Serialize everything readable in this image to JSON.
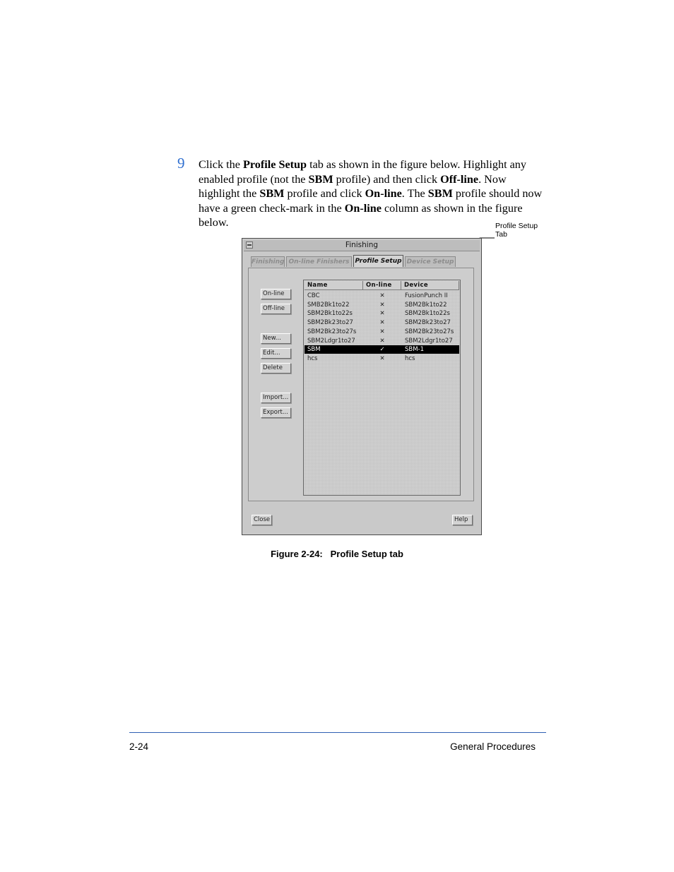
{
  "step": {
    "number": "9",
    "p1": "Click the ",
    "b1": "Profile Setup",
    "p2": " tab as shown in the figure below. Highlight any enabled profile (not the ",
    "b2": "SBM",
    "p3": " profile) and then click ",
    "b3": "Off-line",
    "p4": ". Now highlight the ",
    "b4": "SBM",
    "p5": " profile and click ",
    "b5": "On-line",
    "p6": ". The ",
    "b6": "SBM",
    "p7": " profile should now have a green check-mark in the ",
    "b7": "On-line",
    "p8": " column as shown in the figure below."
  },
  "callout": {
    "line1": "Profile Setup",
    "line2": "Tab"
  },
  "window": {
    "title": "Finishing",
    "tabs": [
      "Finishing",
      "On-line Finishers",
      "Profile Setup",
      "Device Setup"
    ],
    "active_tab": "Profile Setup",
    "side_buttons": [
      "On-line",
      "Off-line",
      "New...",
      "Edit...",
      "Delete",
      "Import...",
      "Export..."
    ],
    "columns": [
      "Name",
      "On-line",
      "Device"
    ],
    "rows": [
      {
        "name": "CBC",
        "online": "✕",
        "device": "FusionPunch II"
      },
      {
        "name": "SMB2Bk1to22",
        "online": "✕",
        "device": "SBM2Bk1to22"
      },
      {
        "name": "SBM2Bk1to22s",
        "online": "✕",
        "device": "SBM2Bk1to22s"
      },
      {
        "name": "SBM2Bk23to27",
        "online": "✕",
        "device": "SBM2Bk23to27"
      },
      {
        "name": "SBM2Bk23to27s",
        "online": "✕",
        "device": "SBM2Bk23to27s"
      },
      {
        "name": "SBM2Ldgr1to27",
        "online": "✕",
        "device": "SBM2Ldgr1to27"
      },
      {
        "name": "SBM",
        "online": "✓",
        "device": "SBM-1"
      },
      {
        "name": "hcs",
        "online": "✕",
        "device": "hcs"
      }
    ],
    "selected_row": "SBM",
    "close_label": "Close",
    "help_label": "Help"
  },
  "caption": {
    "label": "Figure 2-24:",
    "title": "Profile Setup tab"
  },
  "footer": {
    "page": "2-24",
    "section": "General Procedures"
  },
  "colors": {
    "step_number": "#2f6fd0",
    "rule": "#2f5fb3",
    "selection": "#000000"
  }
}
